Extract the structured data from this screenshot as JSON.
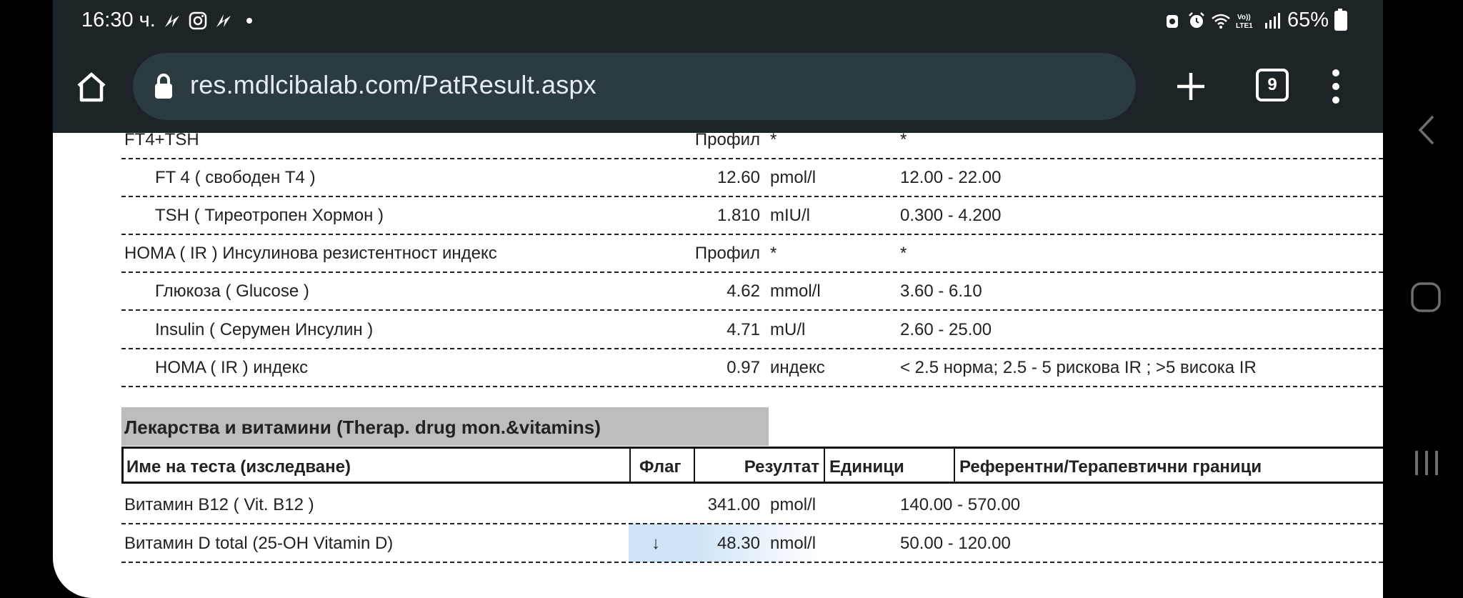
{
  "status_bar": {
    "time": "16:30 ч.",
    "battery": "65%"
  },
  "browser": {
    "url": "res.mdlcibalab.com/PatResult.aspx",
    "tab_count": "9"
  },
  "rows": [
    {
      "name": "FT4+TSH",
      "result": "Профил",
      "unit": "*",
      "ref": "*",
      "indent": false
    },
    {
      "name": "FT 4 ( свободен T4 )",
      "result": "12.60",
      "unit": "pmol/l",
      "ref": "12.00 - 22.00",
      "indent": true
    },
    {
      "name": "TSH ( Тиреотропен Хормон )",
      "result": "1.810",
      "unit": "mIU/l",
      "ref": "0.300 - 4.200",
      "indent": true
    },
    {
      "name": "HOMA ( IR ) Инсулинова резистентност индекс",
      "result": "Профил",
      "unit": "*",
      "ref": "*",
      "indent": false
    },
    {
      "name": "Глюкоза ( Glucose )",
      "result": "4.62",
      "unit": "mmol/l",
      "ref": "3.60 - 6.10",
      "indent": true
    },
    {
      "name": "Insulin ( Серумен Инсулин )",
      "result": "4.71",
      "unit": "mU/l",
      "ref": "2.60 - 25.00",
      "indent": true
    },
    {
      "name": "HOMA ( IR ) индекс",
      "result": "0.97",
      "unit": "индекс",
      "ref": "< 2.5 норма; 2.5 - 5 рискова IR ; >5 висока IR",
      "indent": true
    }
  ],
  "section": {
    "title": "Лекарства и витамини (Therap. drug mon.&vitamins)"
  },
  "table_header": {
    "name": "Име на теста (изследване)",
    "flag": "Флаг",
    "result": "Резултат",
    "unit": "Единици",
    "ref": "Референтни/Терапевтични граници"
  },
  "vitamin_rows": [
    {
      "name": "Витамин B12 ( Vit. B12 )",
      "flag": "",
      "result": "341.00",
      "unit": "pmol/l",
      "ref": "140.00 - 570.00"
    },
    {
      "name": "Витамин D total (25-OH Vitamin D)",
      "flag": "↓",
      "result": "48.30",
      "unit": "nmol/l",
      "ref": "50.00 - 120.00"
    }
  ],
  "colors": {
    "browser_bar": "#1c2427",
    "url_field": "#2b3b40",
    "section_bg": "#bdbdbd",
    "flag_low": "#cfe3f6"
  }
}
